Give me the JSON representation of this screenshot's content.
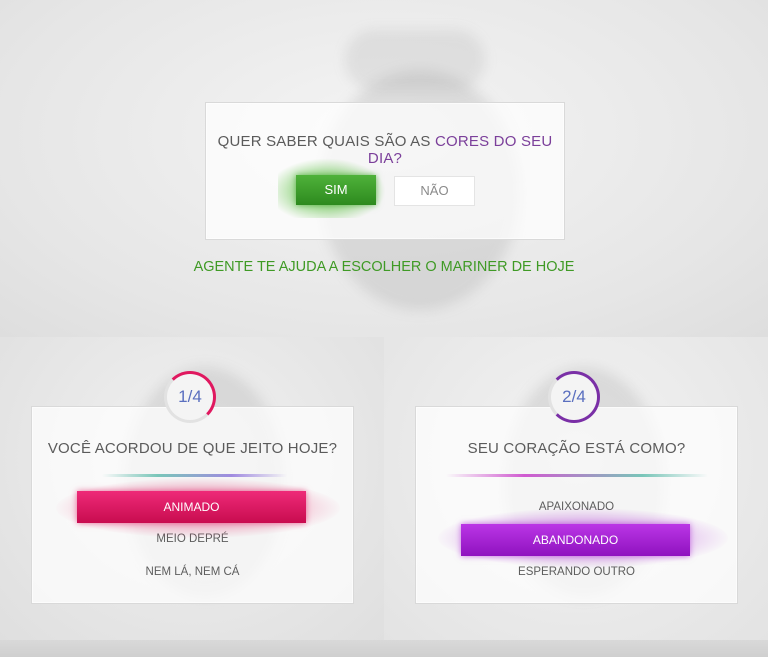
{
  "intro": {
    "question_prefix": "QUER SABER QUAIS SÃO AS ",
    "question_accent": "CORES DO SEU DIA?",
    "yes_label": "SIM",
    "no_label": "NÃO",
    "tagline": "AGENTE TE AJUDA A ESCOLHER O MARINER DE HOJE"
  },
  "cards": [
    {
      "step": "1/4",
      "question": "VOCÊ ACORDOU DE QUE JEITO HOJE?",
      "options": [
        "ANIMADO",
        "MEIO DEPRÉ",
        "NEM LÁ, NEM CÁ"
      ],
      "selected": "ANIMADO",
      "accent_color": "#e0185f"
    },
    {
      "step": "2/4",
      "question": "SEU CORAÇÃO ESTÁ COMO?",
      "options": [
        "APAIXONADO",
        "ABANDONADO",
        "ESPERANDO OUTRO"
      ],
      "selected": "ABANDONADO",
      "accent_color": "#a51ad1"
    }
  ],
  "colors": {
    "green": "#3f9a25",
    "pink": "#e0185f",
    "purple": "#a51ad1",
    "step_blue": "#5a6fbf"
  }
}
